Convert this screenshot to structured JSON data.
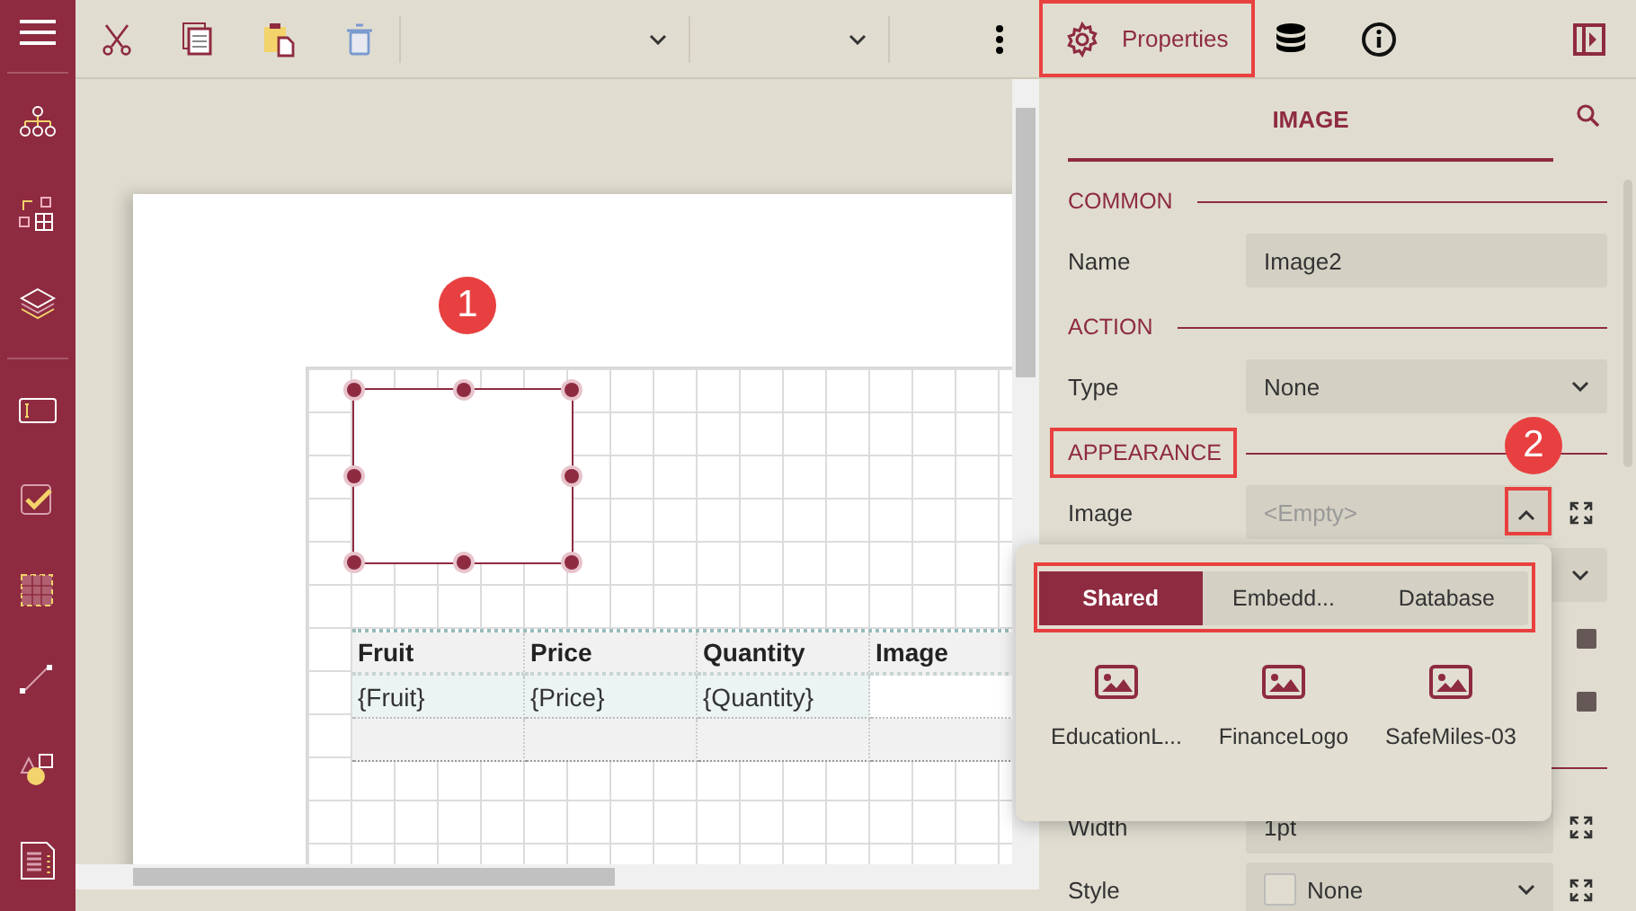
{
  "panel_tabs": [
    {
      "label": "Properties",
      "selected": true
    }
  ],
  "report": {
    "image_item": {
      "selected": true
    },
    "table": {
      "columns": [
        "Fruit",
        "Price",
        "Quantity",
        "Image"
      ],
      "rows": [
        {
          "cells": [
            "{Fruit}",
            "{Price}",
            "{Quantity}"
          ]
        }
      ]
    }
  },
  "properties": {
    "title": "IMAGE",
    "sections": [
      {
        "title": "COMMON",
        "rows": [
          {
            "label": "Name",
            "kind": "text",
            "value": "Image2",
            "expandable": false
          }
        ]
      },
      {
        "title": "ACTION",
        "rows": [
          {
            "label": "Type",
            "kind": "dropdown",
            "value": "None",
            "expandable": false
          }
        ]
      },
      {
        "title": "APPEARANCE",
        "rows": [
          {
            "label": "Image",
            "kind": "picker",
            "placeholder": "<Empty>",
            "expanded": true,
            "expandable": true
          },
          {
            "kind": "dropdown",
            "expandable": false
          },
          {
            "kind": "swatch",
            "expandable": false
          },
          {
            "kind": "swatch",
            "expandable": false
          }
        ]
      },
      {
        "rows": [
          {
            "label": "Width",
            "kind": "text",
            "value": "1pt",
            "expandable": true
          },
          {
            "label": "Style",
            "kind": "border",
            "value": "None",
            "expandable": true
          }
        ]
      }
    ]
  },
  "image_picker": {
    "tabs": [
      {
        "label": "Shared",
        "selected": true
      },
      {
        "label": "Embedd...",
        "selected": false
      },
      {
        "label": "Database",
        "selected": false
      }
    ],
    "items": [
      {
        "label": "EducationL..."
      },
      {
        "label": "FinanceLogo"
      },
      {
        "label": "SafeMiles-03"
      }
    ]
  },
  "annotations": [
    {
      "label": "1"
    },
    {
      "label": "2"
    }
  ]
}
